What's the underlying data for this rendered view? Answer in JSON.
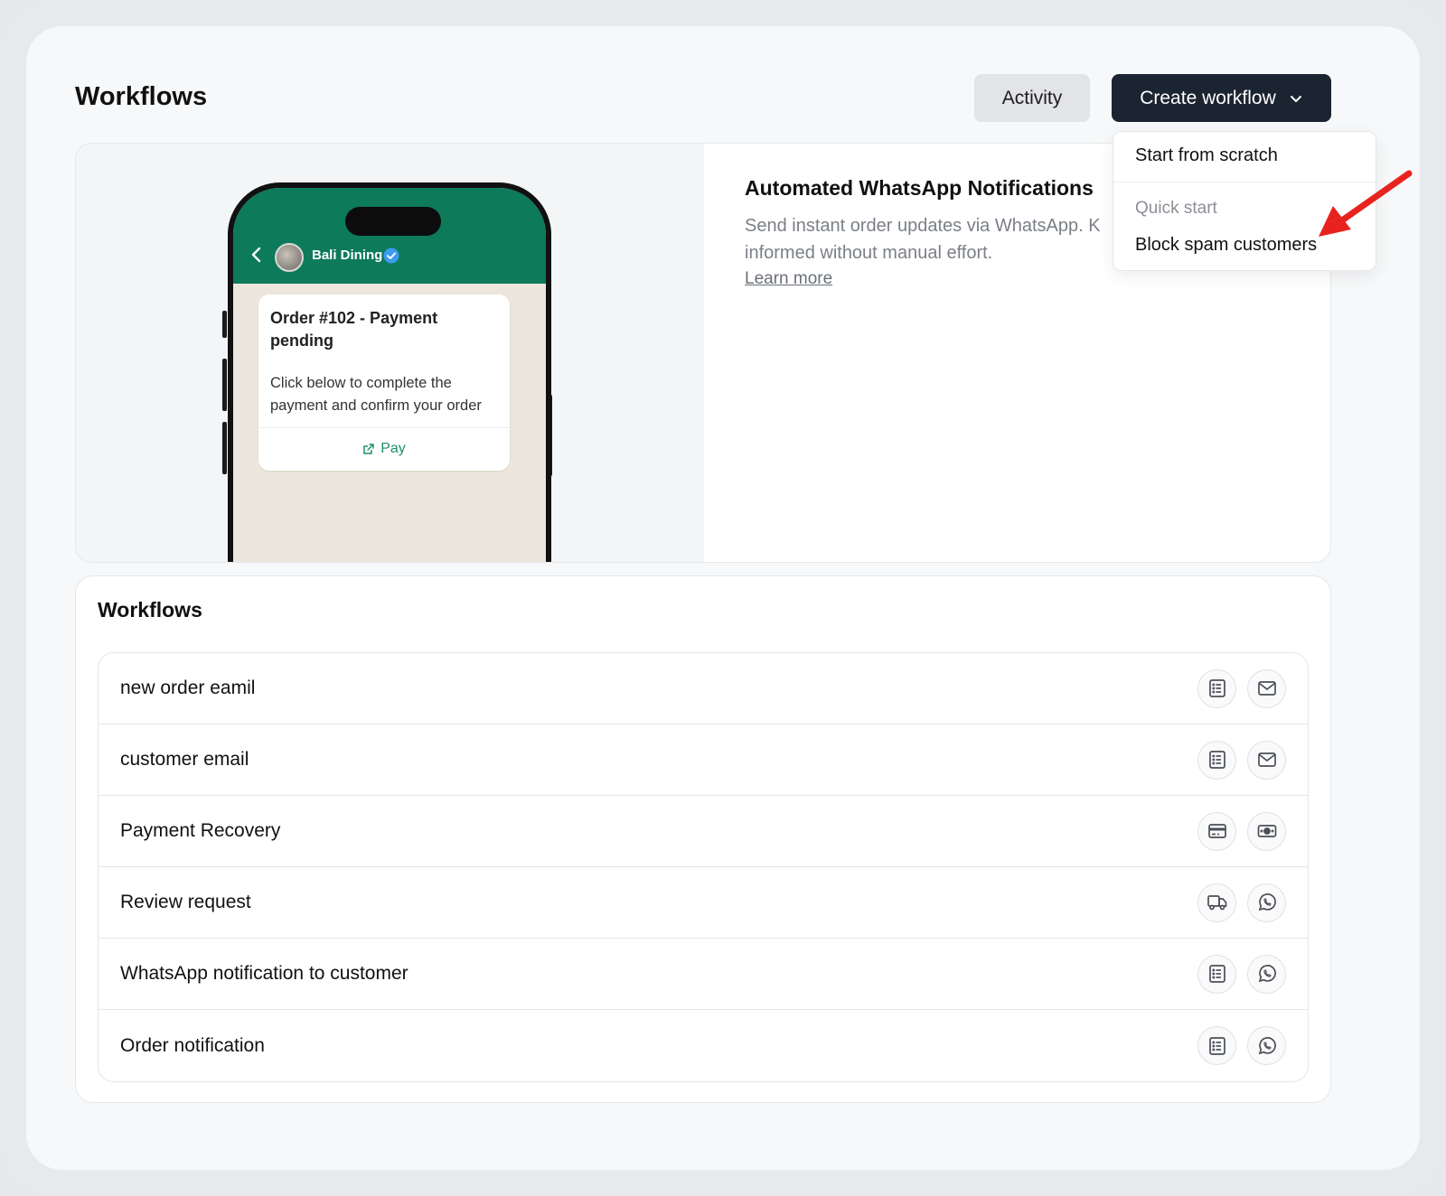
{
  "header": {
    "title": "Workflows",
    "activity_label": "Activity",
    "create_label": "Create workflow"
  },
  "dropdown": {
    "items": [
      {
        "label": "Start from scratch"
      }
    ],
    "section_label": "Quick start",
    "quick_start_items": [
      {
        "label": "Block spam customers"
      }
    ]
  },
  "hero": {
    "title": "Automated WhatsApp Notifications",
    "description": "Send instant order updates via WhatsApp. K",
    "description_line2": "informed without manual effort.",
    "link": "Learn more",
    "preview": {
      "contact_name": "Bali Dining",
      "message_title": "Order #102 - Payment pending",
      "message_body": "Click below to complete the payment and confirm your order",
      "button_label": "Pay"
    }
  },
  "workflows": {
    "title": "Workflows",
    "rows": [
      {
        "name": "new order eamil",
        "icons": [
          "list-icon",
          "mail-icon"
        ]
      },
      {
        "name": "customer email",
        "icons": [
          "list-icon",
          "mail-icon"
        ]
      },
      {
        "name": "Payment Recovery",
        "icons": [
          "credit-card-icon",
          "cash-icon"
        ]
      },
      {
        "name": "Review request",
        "icons": [
          "truck-icon",
          "whatsapp-icon"
        ]
      },
      {
        "name": "WhatsApp notification to customer",
        "icons": [
          "list-icon",
          "whatsapp-icon"
        ]
      },
      {
        "name": "Order notification",
        "icons": [
          "list-icon",
          "whatsapp-icon"
        ]
      }
    ]
  },
  "colors": {
    "primary_button": "#1b2431",
    "whatsapp_header": "#0d7a5a",
    "annotation_arrow": "#e8231e"
  }
}
